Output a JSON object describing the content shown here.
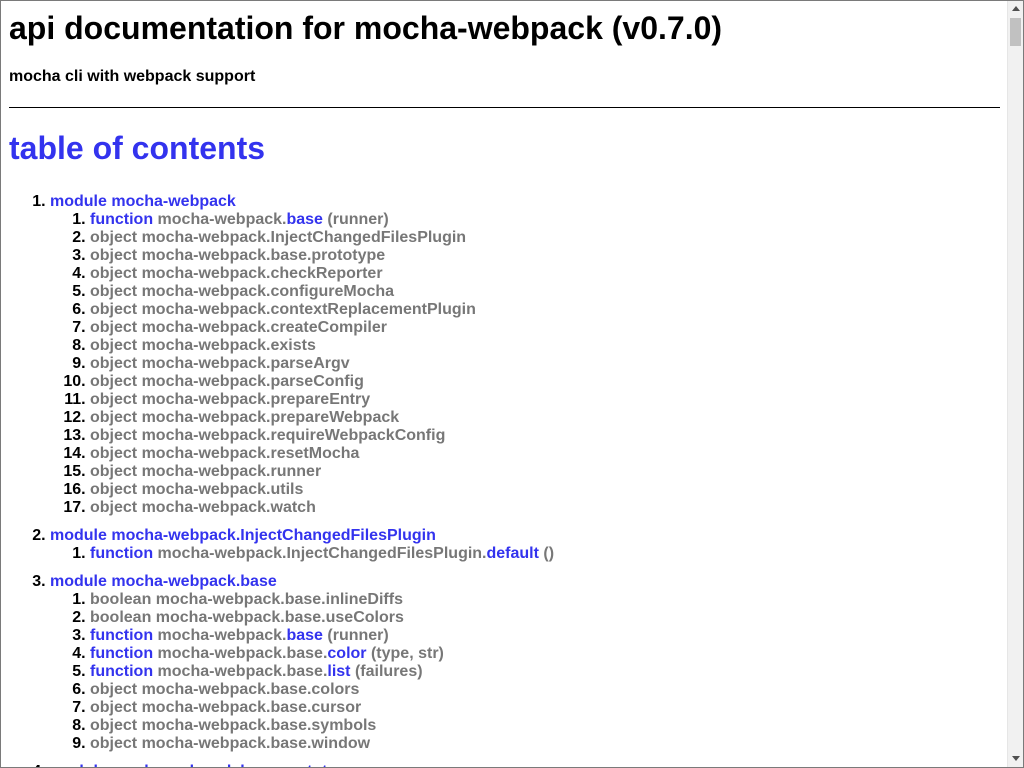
{
  "page": {
    "title": "api documentation for mocha-webpack (v0.7.0)",
    "subtitle": "mocha cli with webpack support",
    "toc_heading": "table of contents"
  },
  "modules": [
    {
      "label": "module mocha-webpack",
      "members": [
        {
          "kind": "function",
          "prefix": "mocha-webpack.",
          "name": "base",
          "args": "(runner)"
        },
        {
          "text": "object mocha-webpack.InjectChangedFilesPlugin"
        },
        {
          "text": "object mocha-webpack.base.prototype"
        },
        {
          "text": "object mocha-webpack.checkReporter"
        },
        {
          "text": "object mocha-webpack.configureMocha"
        },
        {
          "text": "object mocha-webpack.contextReplacementPlugin"
        },
        {
          "text": "object mocha-webpack.createCompiler"
        },
        {
          "text": "object mocha-webpack.exists"
        },
        {
          "text": "object mocha-webpack.parseArgv"
        },
        {
          "text": "object mocha-webpack.parseConfig"
        },
        {
          "text": "object mocha-webpack.prepareEntry"
        },
        {
          "text": "object mocha-webpack.prepareWebpack"
        },
        {
          "text": "object mocha-webpack.requireWebpackConfig"
        },
        {
          "text": "object mocha-webpack.resetMocha"
        },
        {
          "text": "object mocha-webpack.runner"
        },
        {
          "text": "object mocha-webpack.utils"
        },
        {
          "text": "object mocha-webpack.watch"
        }
      ]
    },
    {
      "label": "module mocha-webpack.InjectChangedFilesPlugin",
      "members": [
        {
          "kind": "function",
          "prefix": "mocha-webpack.InjectChangedFilesPlugin.",
          "name": "default",
          "args": "()"
        }
      ]
    },
    {
      "label": "module mocha-webpack.base",
      "members": [
        {
          "text": "boolean mocha-webpack.base.inlineDiffs"
        },
        {
          "text": "boolean mocha-webpack.base.useColors"
        },
        {
          "kind": "function",
          "prefix": "mocha-webpack.",
          "name": "base",
          "args": "(runner)"
        },
        {
          "kind": "function",
          "prefix": "mocha-webpack.base.",
          "name": "color",
          "args": "(type, str)"
        },
        {
          "kind": "function",
          "prefix": "mocha-webpack.base.",
          "name": "list",
          "args": "(failures)"
        },
        {
          "text": "object mocha-webpack.base.colors"
        },
        {
          "text": "object mocha-webpack.base.cursor"
        },
        {
          "text": "object mocha-webpack.base.symbols"
        },
        {
          "text": "object mocha-webpack.base.window"
        }
      ]
    },
    {
      "label": "module mocha-webpack.base.prototype",
      "members": []
    }
  ]
}
